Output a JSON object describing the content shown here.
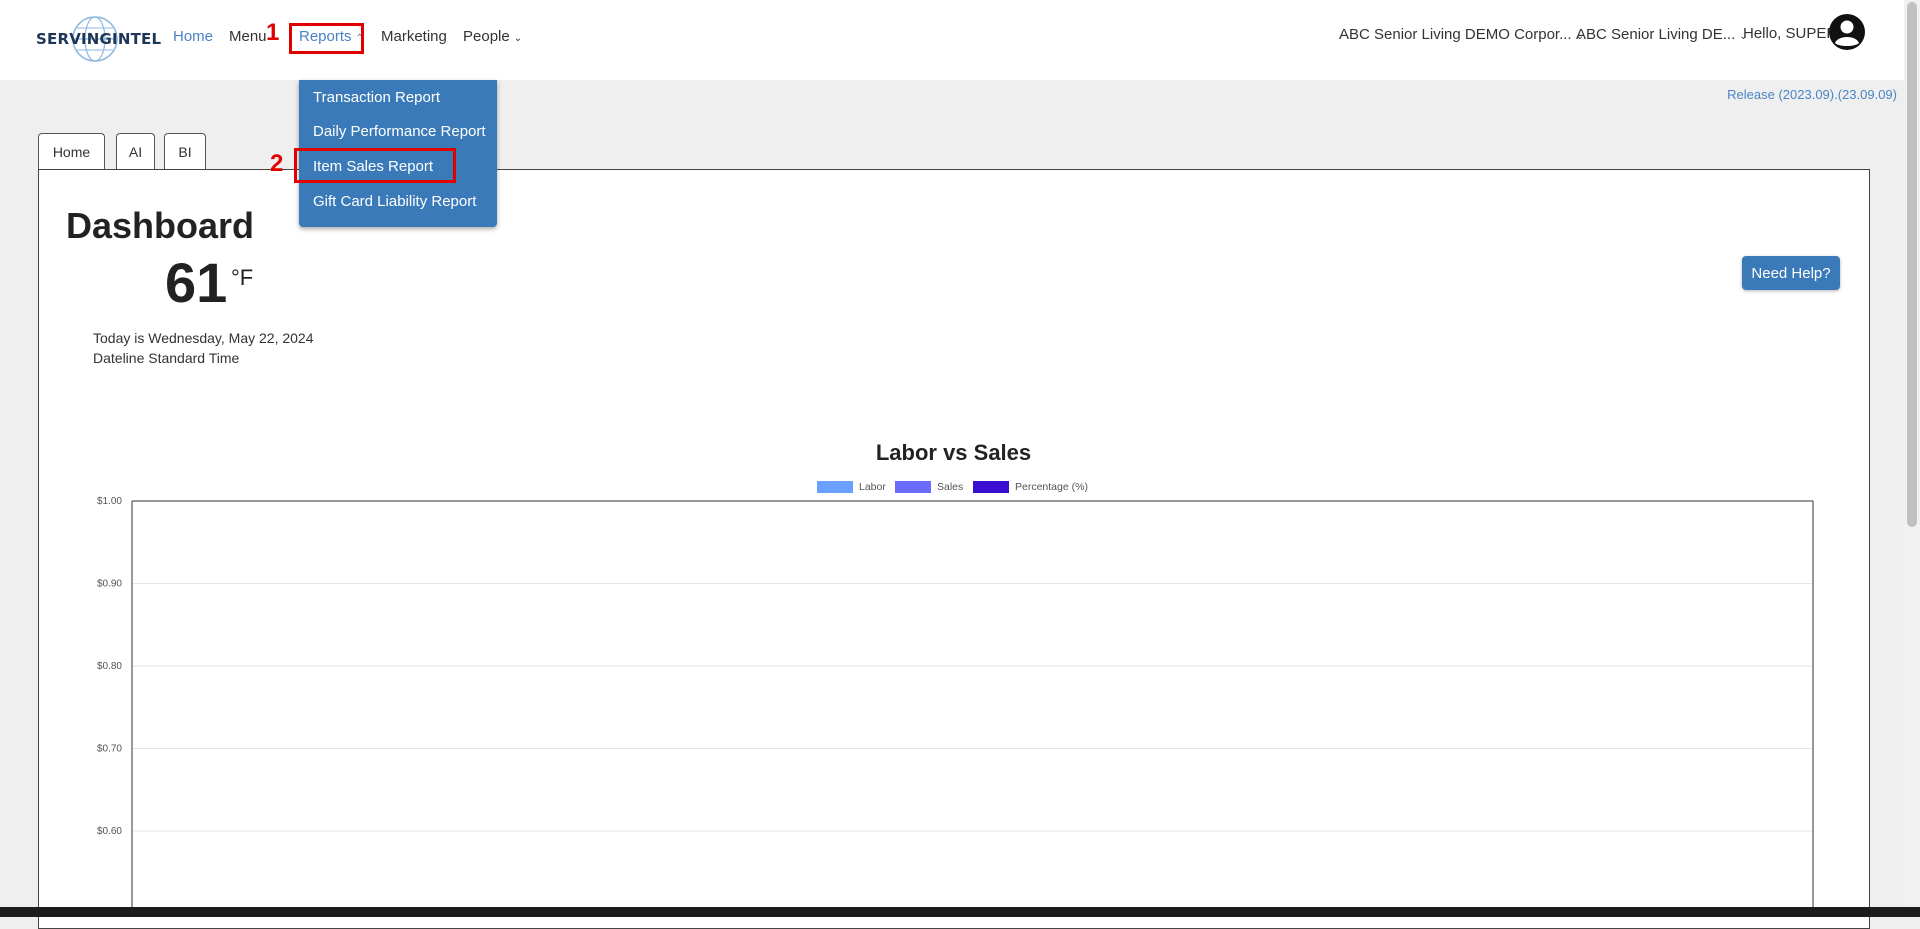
{
  "header": {
    "logo_text": "SERVINGINTEL",
    "nav": {
      "home": "Home",
      "menu": "Menu",
      "reports": "Reports",
      "marketing": "Marketing",
      "people": "People"
    },
    "corp_select_1": "ABC Senior Living DEMO Corpor...",
    "corp_select_2": "ABC Senior Living DE...",
    "greeting": "Hello, SUPER",
    "chevron": "⌄"
  },
  "annotations": {
    "step1": "1",
    "step2": "2"
  },
  "reports_menu": {
    "items": [
      "Transaction Report",
      "Daily Performance Report",
      "Item Sales Report",
      "Gift Card Liability Report"
    ]
  },
  "release": "Release (2023.09).(23.09.09)",
  "tabs": [
    "Home",
    "AI",
    "BI"
  ],
  "dashboard": {
    "title": "Dashboard",
    "temperature": "61",
    "unit": "°F",
    "date": "Today is Wednesday, May 22, 2024",
    "timezone": "Dateline Standard Time",
    "help_button": "Need Help?"
  },
  "chart_data": {
    "type": "bar",
    "title": "Labor vs Sales",
    "legend_position": "top",
    "grid": true,
    "series": [
      {
        "name": "Labor",
        "color": "#6aa0ff",
        "values": []
      },
      {
        "name": "Sales",
        "color": "#6b6bff",
        "values": []
      },
      {
        "name": "Percentage (%)",
        "color": "#3a0fd0",
        "values": []
      }
    ],
    "ytick_labels": [
      "$1.00",
      "$0.90",
      "$0.80",
      "$0.70",
      "$0.60"
    ],
    "yticks": [
      1.0,
      0.9,
      0.8,
      0.7,
      0.6
    ],
    "ylim_visible": [
      0.55,
      1.0
    ]
  },
  "colors": {
    "accent": "#3a7ab8",
    "link": "#4a84c4",
    "annotation": "#e00000"
  }
}
